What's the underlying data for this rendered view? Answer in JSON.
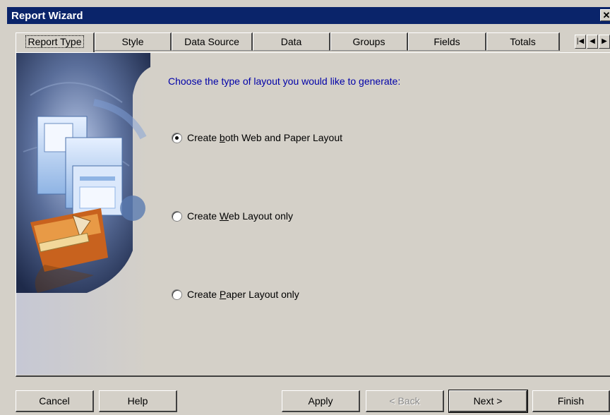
{
  "window": {
    "title": "Report Wizard",
    "close_glyph": "✕"
  },
  "tabs": [
    {
      "label": "Report Type",
      "active": true
    },
    {
      "label": "Style"
    },
    {
      "label": "Data Source"
    },
    {
      "label": "Data"
    },
    {
      "label": "Groups"
    },
    {
      "label": "Fields"
    },
    {
      "label": "Totals"
    }
  ],
  "tab_nav": {
    "first": "|◀",
    "prev": "◀",
    "next": "▶",
    "last": "▶|"
  },
  "content": {
    "prompt": "Choose the type of layout you would like to generate:",
    "options": [
      {
        "before": "Create ",
        "mnemonic": "b",
        "after": "oth Web and Paper Layout",
        "selected": true
      },
      {
        "before": "Create ",
        "mnemonic": "W",
        "after": "eb Layout only",
        "selected": false
      },
      {
        "before": "Create ",
        "mnemonic": "P",
        "after": "aper Layout only",
        "selected": false
      }
    ]
  },
  "buttons": {
    "cancel": "Cancel",
    "help": "Help",
    "apply": "Apply",
    "back": "< Back",
    "next": "Next >",
    "finish": "Finish"
  },
  "colors": {
    "title_bar": "#0a246a",
    "prompt_text": "#0000a8",
    "dialog_face": "#d4d0c8"
  }
}
